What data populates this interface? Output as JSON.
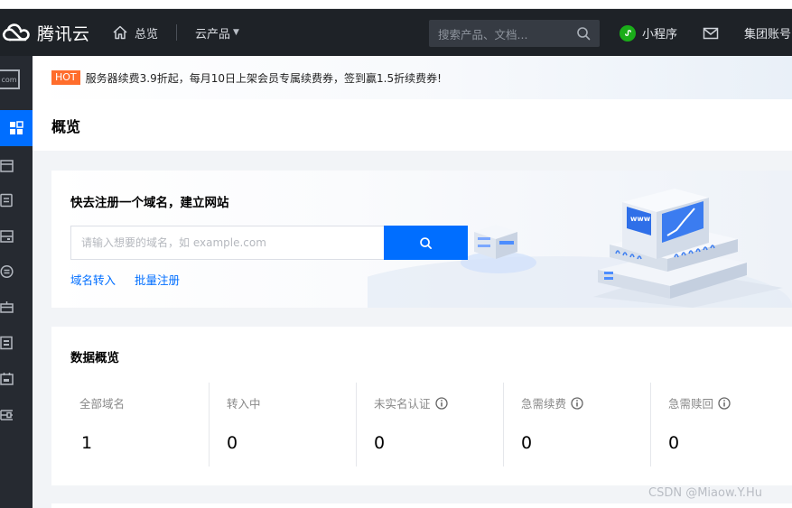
{
  "nav": {
    "brand": "腾讯云",
    "overview": "总览",
    "products": "云产品",
    "search_placeholder": "搜索产品、文档...",
    "mini_program": "小程序",
    "group_account": "集团账号"
  },
  "sidebar": {
    "com_badge": "com"
  },
  "banner": {
    "hot": "HOT",
    "text": "服务器续费3.9折起，每月10日上架会员专属续费券，签到赢1.5折续费券!"
  },
  "page": {
    "title": "概览"
  },
  "register": {
    "title": "快去注册一个域名，建立网站",
    "input_placeholder": "请输入想要的域名，如 example.com",
    "link_transfer": "域名转入",
    "link_bulk": "批量注册"
  },
  "overview": {
    "title": "数据概览",
    "stats": [
      {
        "label": "全部域名",
        "value": "1"
      },
      {
        "label": "转入中",
        "value": "0"
      },
      {
        "label": "未实名认证",
        "value": "0"
      },
      {
        "label": "急需续费",
        "value": "0"
      },
      {
        "label": "急需赎回",
        "value": "0"
      }
    ]
  },
  "illustration": {
    "server_label": "www"
  },
  "watermark": "CSDN @Miaow.Y.Hu",
  "colors": {
    "brand_blue": "#006eff",
    "nav_bg": "#1e2227",
    "sidebar_bg": "#262a31",
    "hot_orange": "#ff6d2c"
  }
}
